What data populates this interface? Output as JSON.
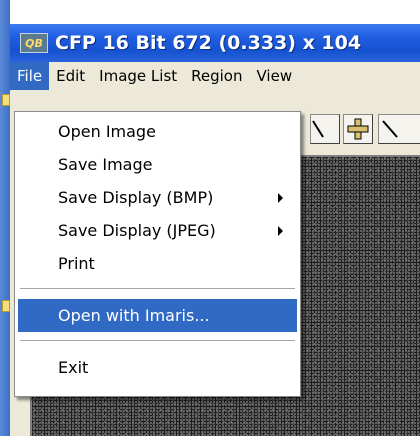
{
  "window": {
    "title": "CFP 16 Bit 672 (0.333) x 104",
    "icon_label": "QB"
  },
  "menubar": {
    "items": [
      "File",
      "Edit",
      "Image List",
      "Region",
      "View"
    ],
    "active": "File"
  },
  "toolbar": {
    "buttons": [
      "partial-button-icon",
      "crosshair-plus-icon",
      "line-tool-icon"
    ]
  },
  "file_menu": {
    "items": [
      {
        "label": "Open  Image",
        "submenu": false
      },
      {
        "label": "Save Image",
        "submenu": false
      },
      {
        "label": "Save Display (BMP)",
        "submenu": true
      },
      {
        "label": "Save Display (JPEG)",
        "submenu": true
      },
      {
        "label": "Print",
        "submenu": false
      },
      {
        "label": "Open with Imaris...",
        "submenu": false,
        "highlighted": true
      },
      {
        "label": "Exit",
        "submenu": false
      }
    ]
  },
  "colors": {
    "titlebar": "#1f5ee0",
    "menu_highlight": "#316ac5",
    "menubar_bg": "#ece9d8"
  }
}
